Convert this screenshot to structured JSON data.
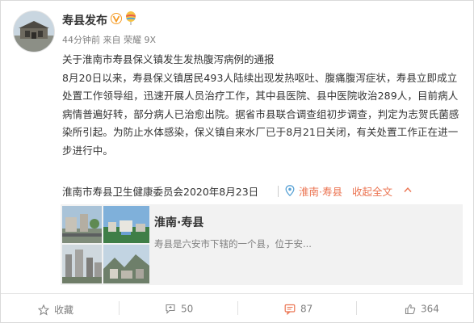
{
  "account": {
    "name": "寿县发布",
    "verified_badge": "verified-v-icon",
    "meta": "44分钟前 来自 荣耀 9X"
  },
  "post": {
    "title": "关于淮南市寿县保义镇发生发热腹泻病例的通报",
    "body": "8月20日以来，寿县保义镇居民493人陆续出现发热呕吐、腹痛腹泻症状，寿县立即成立处置工作领导组，迅速开展人员治疗工作，其中县医院、县中医院收治289人，目前病人病情普遍好转，部分病人已治愈出院。据省市县联合调查组初步调查，判定为志贺氏菌感染所引起。为防止水体感染，保义镇自来水厂已于8月21日关闭，有关处置工作正在进一步进行中。",
    "source": "淮南市寿县卫生健康委员会2020年8月23日",
    "location": "淮南·寿县",
    "collapse_label": "收起全文"
  },
  "location_card": {
    "title": "淮南·寿县",
    "description": "寿县是六安市下辖的一个县，位于安..."
  },
  "actions": {
    "favorite": "收藏",
    "repost": "50",
    "comment": "87",
    "like": "364"
  },
  "colors": {
    "accent": "#eb7350",
    "text": "#333333",
    "muted": "#808080"
  }
}
